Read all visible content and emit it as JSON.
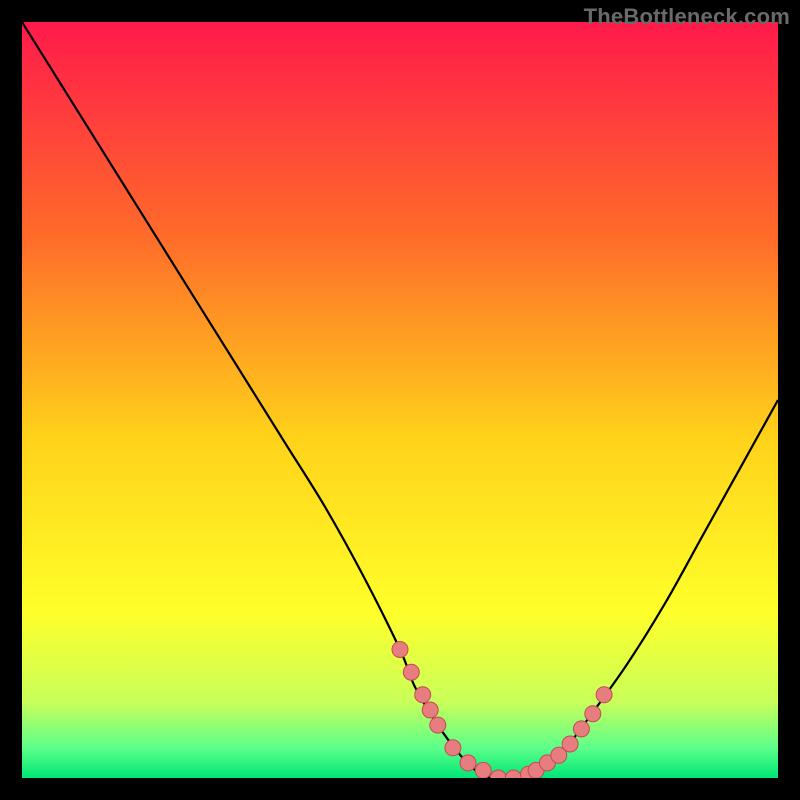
{
  "watermark": {
    "text": "TheBottleneck.com"
  },
  "colors": {
    "top": "#ff1a4b",
    "mid1": "#ff6a2a",
    "mid2": "#ffd21a",
    "mid3": "#ffff2a",
    "low1": "#c8ff5a",
    "low2": "#5dff8a",
    "bottom": "#00e676",
    "curve": "#000000",
    "dot_fill": "#e77d7f",
    "dot_stroke": "#c24b53",
    "bg": "#000000"
  },
  "chart_data": {
    "type": "line",
    "title": "",
    "xlabel": "",
    "ylabel": "",
    "xlim": [
      0,
      100
    ],
    "ylim": [
      0,
      100
    ],
    "series": [
      {
        "name": "bottleneck-curve",
        "x": [
          0,
          5,
          10,
          15,
          20,
          25,
          30,
          35,
          40,
          45,
          50,
          52,
          55,
          58,
          60,
          62,
          64,
          66,
          68,
          70,
          72,
          75,
          80,
          85,
          90,
          95,
          100
        ],
        "y": [
          100,
          92,
          84,
          76,
          68,
          60,
          52,
          44,
          36,
          27,
          17,
          12,
          7,
          3,
          1,
          0,
          0,
          0,
          1,
          2,
          4,
          8,
          15,
          23,
          32,
          41,
          50
        ]
      }
    ],
    "markers": {
      "name": "highlight-dots",
      "x": [
        50,
        51.5,
        53,
        54,
        55,
        57,
        59,
        61,
        63,
        65,
        67,
        68,
        69.5,
        71,
        72.5,
        74,
        75.5,
        77
      ],
      "y": [
        17,
        14,
        11,
        9,
        7,
        4,
        2,
        1,
        0,
        0,
        0.5,
        1,
        2,
        3,
        4.5,
        6.5,
        8.5,
        11
      ]
    }
  }
}
